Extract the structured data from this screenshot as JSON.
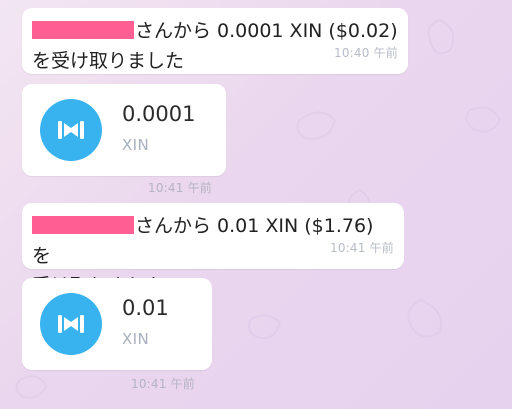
{
  "messages": [
    {
      "line1_suffix": "さんから 0.0001 XIN ($0.02)",
      "line2": "を受け取りました",
      "time": "10:40 午前"
    },
    {
      "line1_suffix": "さんから 0.01 XIN ($1.76) を",
      "line2": "受け取りました",
      "time": "10:41 午前"
    }
  ],
  "transfers": [
    {
      "amount": "0.0001",
      "symbol": "XIN",
      "time": "10:41 午前",
      "icon": "mixin-xin-icon"
    },
    {
      "amount": "0.01",
      "symbol": "XIN",
      "time": "10:41 午前",
      "icon": "mixin-xin-icon"
    }
  ],
  "colors": {
    "accent": "#38b3ef",
    "redaction": "#ff5f93"
  }
}
